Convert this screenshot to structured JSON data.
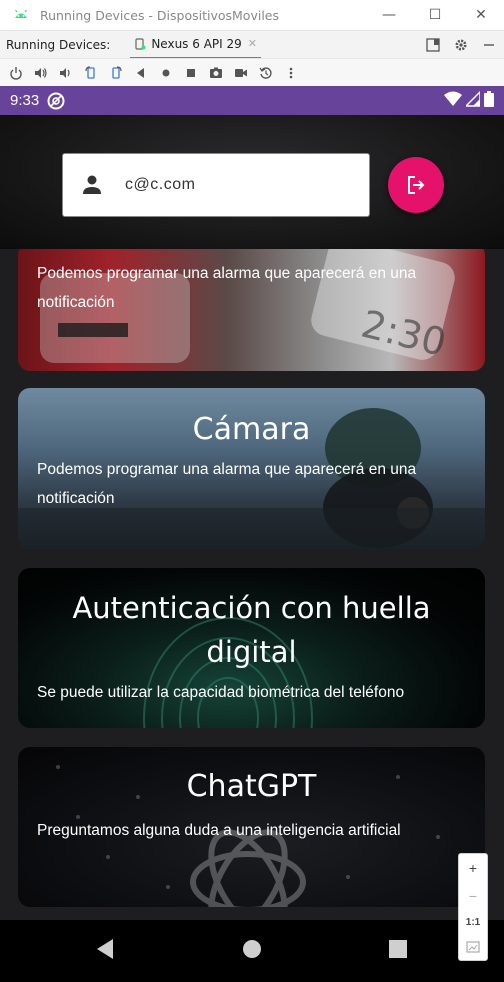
{
  "window": {
    "title": "Running Devices - DispositivosMoviles",
    "controls": [
      "—",
      "☐",
      "✕"
    ]
  },
  "tabbar": {
    "label": "Running Devices:",
    "tab_label": "Nexus 6 API 29",
    "tab_close": "✕"
  },
  "toolbar": {
    "icons": [
      "power-icon",
      "volume-up-icon",
      "volume-down-icon",
      "rotate-left-icon",
      "rotate-right-icon",
      "back-icon",
      "home-icon",
      "overview-icon",
      "screenshot-icon",
      "screen-record-icon",
      "snapshot-icon",
      "more-icon"
    ]
  },
  "status": {
    "time": "9:33"
  },
  "user": {
    "email": "c@c.com"
  },
  "cards": [
    {
      "title": "",
      "description": "Podemos programar una alarma que aparecerá en una notificación"
    },
    {
      "title": "Cámara",
      "description": "Podemos programar una alarma que aparecerá en una notificación"
    },
    {
      "title": "Autenticación con huella digital",
      "description": "Se puede utilizar la capacidad biométrica del teléfono"
    },
    {
      "title": "ChatGPT",
      "description": "Preguntamos alguna duda a una inteligencia artificial"
    }
  ],
  "zoom": {
    "plus": "+",
    "minus": "−",
    "one_to_one": "1:1"
  },
  "colors": {
    "status_bar": "#67439a",
    "logout_button": "#e4126b",
    "screen_background": "#1e1e20"
  }
}
